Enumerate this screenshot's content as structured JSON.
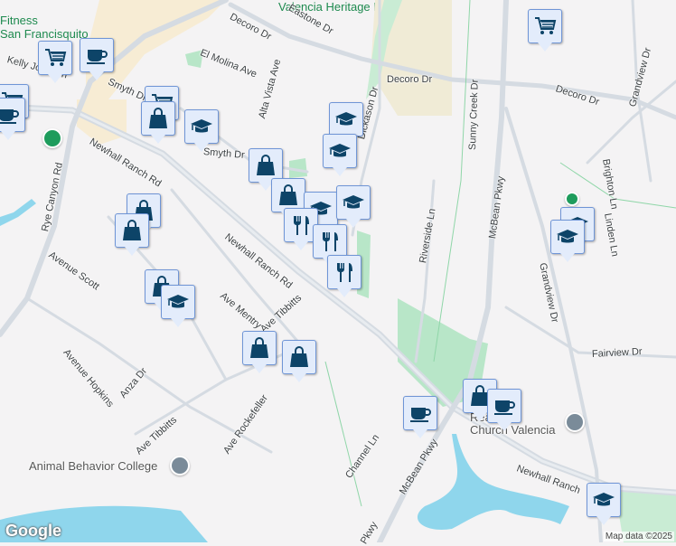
{
  "roads": [
    "Decoro Dr",
    "Decoro Dr",
    "Decoro Dr",
    "El Molina Ave",
    "Alta Vista Ave",
    "Dickason Dr",
    "Smyth Dr",
    "Smyth Dr",
    "Kelly Johnson",
    "Newhall Ranch Rd",
    "Newhall Ranch Rd",
    "Newhall Ranch",
    "Rye Canyon Rd",
    "Avenue Scott",
    "Avenue Hopkins",
    "Anza Dr",
    "Ave Mentry",
    "Ave Tibbitts",
    "Ave Tibbitts",
    "Ave Rockefeller",
    "Channel Ln",
    "McBean Pkwy",
    "McBean Pkwy",
    "Pkwy",
    "Riverside Ln",
    "Sunny Creek Dr",
    "Grandview Dr",
    "Grandview Dr",
    "Brighton Ln",
    "Linden Ln",
    "Fairview Dr",
    "Eastone Dr"
  ],
  "places": {
    "park": "Valencia Heritage Park",
    "church": "Real Life Church Valencia",
    "college": "Animal Behavior College",
    "fitness": "Fitness",
    "canyon": "San Francisquito Canyon"
  },
  "markers": [
    "shopping-cart",
    "coffee",
    "shopping-cart",
    "coffee",
    "shopping-cart",
    "shopping-bag",
    "school",
    "school",
    "school",
    "shopping-bag",
    "shopping-bag",
    "shopping-bag",
    "shopping-bag",
    "school",
    "school",
    "restaurant",
    "restaurant",
    "restaurant",
    "shopping-bag",
    "school",
    "shopping-bag",
    "shopping-bag",
    "shopping-cart",
    "school",
    "school",
    "coffee",
    "shopping-bag",
    "coffee",
    "school"
  ],
  "footer": {
    "logo": "Google",
    "credit": "Map data ©2025"
  },
  "colors": {
    "marker_bg": "#e3ecfb",
    "marker_icon": "#0d4468",
    "water": "#8fd6ec",
    "park": "#b8e6c8",
    "road": "#d5dbe2"
  }
}
